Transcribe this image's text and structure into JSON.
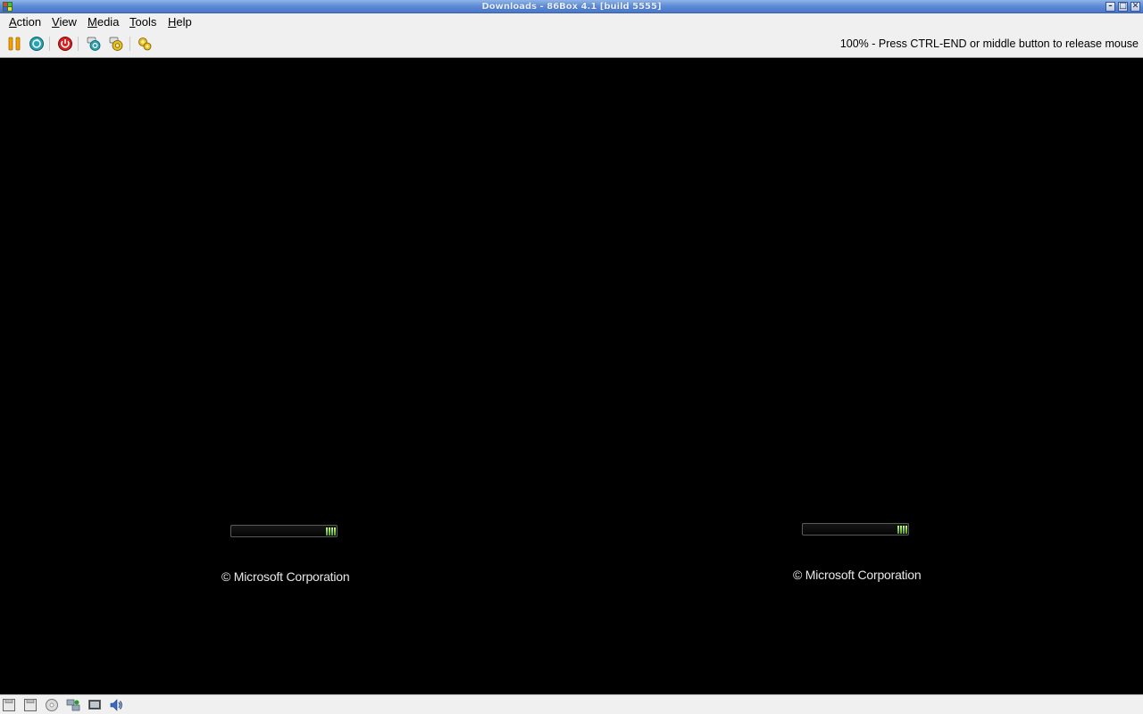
{
  "window": {
    "title": "Downloads - 86Box 4.1 [build 5555]",
    "controls": {
      "minimize": "–",
      "maximize": "□",
      "close": "✕"
    }
  },
  "menu": {
    "items": [
      {
        "label": "Action",
        "mnemonic": "A",
        "rest": "ction"
      },
      {
        "label": "View",
        "mnemonic": "V",
        "rest": "iew"
      },
      {
        "label": "Media",
        "mnemonic": "M",
        "rest": "edia"
      },
      {
        "label": "Tools",
        "mnemonic": "T",
        "rest": "ools"
      },
      {
        "label": "Help",
        "mnemonic": "H",
        "rest": "elp"
      }
    ]
  },
  "toolbar": {
    "buttons": [
      "pause-icon",
      "reset-icon",
      "power-icon",
      "ctrl-alt-del-icon",
      "ctrl-alt-esc-icon",
      "settings-icon"
    ],
    "status_message": "100% - Press CTRL-END or middle button to release mouse"
  },
  "screen": {
    "boot_left": {
      "copyright": "© Microsoft Corporation"
    },
    "boot_right": {
      "copyright": "© Microsoft Corporation"
    }
  },
  "statusbar": {
    "icons": [
      "floppy-drive-1-icon",
      "floppy-drive-2-icon",
      "cdrom-icon",
      "network-icon",
      "display-icon",
      "sound-icon"
    ]
  },
  "colors": {
    "titlebar": "#5c8ad6",
    "chrome": "#f0f0f0",
    "screen": "#000000",
    "progress_chunk": "#8fd64a"
  }
}
